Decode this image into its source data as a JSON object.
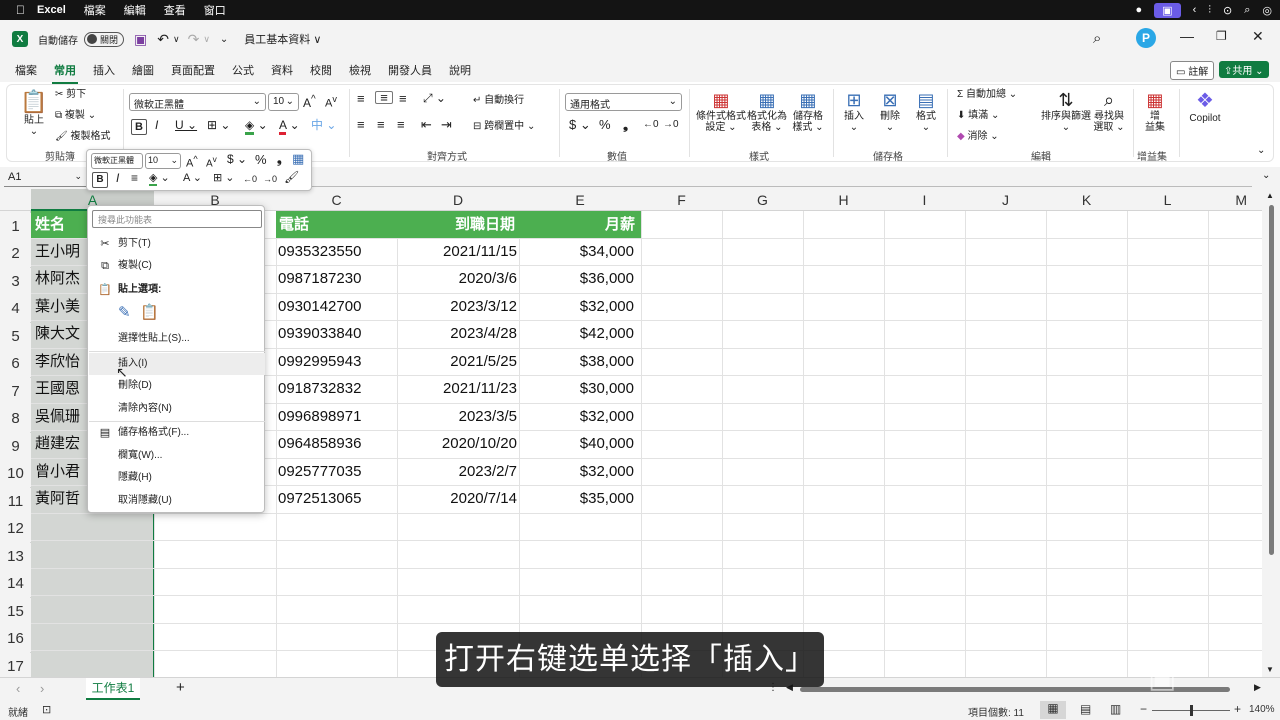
{
  "menubar": {
    "apple": "",
    "app": "Excel",
    "items": [
      "檔案",
      "編輯",
      "查看",
      "窗口"
    ]
  },
  "titlebar": {
    "autosave_label": "自動儲存",
    "autosave_state": "關閉",
    "doc_title": "員工基本資料 ∨"
  },
  "tabs": [
    "檔案",
    "常用",
    "插入",
    "繪圖",
    "頁面配置",
    "公式",
    "資料",
    "校閱",
    "檢視",
    "開發人員",
    "說明"
  ],
  "actions": {
    "comment": "註解",
    "share": "共用"
  },
  "ribbon": {
    "paste": "貼上",
    "cut": "剪下",
    "copy": "複製",
    "format_painter": "複製格式",
    "clipboard_label": "剪貼簿",
    "font_name": "微軟正黑體",
    "font_size": "10",
    "alignment_label": "對齊方式",
    "wrap_text": "自動換行",
    "merge_center": "跨欄置中",
    "number_format": "通用格式",
    "number_label": "數值",
    "cond_format": "條件式格式\n設定",
    "format_table": "格式化為\n表格",
    "cell_styles": "儲存格\n樣式",
    "styles_label": "樣式",
    "insert": "插入",
    "delete": "刪除",
    "format": "格式",
    "cells_label": "儲存格",
    "autosum": "自動加總",
    "fill": "填滿",
    "clear": "消除",
    "sort_filter": "排序與篩選",
    "find_select": "尋找與\n選取",
    "editing_label": "編輯",
    "addins": "增\n益集",
    "addins_label": "增益集",
    "copilot": "Copilot"
  },
  "namebox": "A1",
  "mini_toolbar": {
    "font_name": "微軟正黑體",
    "font_size": "10"
  },
  "columns": [
    "A",
    "B",
    "C",
    "D",
    "E",
    "F",
    "G",
    "H",
    "I",
    "J",
    "K",
    "L",
    "M"
  ],
  "rows": [
    "1",
    "2",
    "3",
    "4",
    "5",
    "6",
    "7",
    "8",
    "9",
    "10",
    "11",
    "12",
    "13",
    "14",
    "15",
    "16",
    "17"
  ],
  "table": {
    "headers": [
      "姓名",
      "電話",
      "到職日期",
      "月薪"
    ],
    "names": [
      "王小明",
      "林阿杰",
      "葉小美",
      "陳大文",
      "李欣怡",
      "王國恩",
      "吳佩珊",
      "趙建宏",
      "曾小君",
      "黃阿哲"
    ],
    "phones": [
      "0935323550",
      "0987187230",
      "0930142700",
      "0939033840",
      "0992995943",
      "0918732832",
      "0996898971",
      "0964858936",
      "0925777035",
      "0972513065"
    ],
    "dates": [
      "2021/11/15",
      "2020/3/6",
      "2023/3/12",
      "2023/4/28",
      "2021/5/25",
      "2021/11/23",
      "2023/3/5",
      "2020/10/20",
      "2023/2/7",
      "2020/7/14"
    ],
    "salaries": [
      "$34,000",
      "$36,000",
      "$32,000",
      "$42,000",
      "$38,000",
      "$30,000",
      "$32,000",
      "$40,000",
      "$32,000",
      "$35,000"
    ]
  },
  "context_menu": {
    "search_placeholder": "搜尋此功能表",
    "cut": "剪下(T)",
    "copy": "複製(C)",
    "paste_options": "貼上選項:",
    "paste_special": "選擇性貼上(S)...",
    "insert": "插入(I)",
    "delete": "刪除(D)",
    "clear": "清除內容(N)",
    "format_cells": "儲存格格式(F)...",
    "col_width": "欄寬(W)...",
    "hide": "隱藏(H)",
    "unhide": "取消隱藏(U)"
  },
  "sheet_tab": "工作表1",
  "status": {
    "ready": "就緒",
    "count": "項目個數: 11",
    "zoom": "140%"
  },
  "subtitle": "打开右键选单选择「插入」",
  "colors": {
    "excel_green": "#107c41",
    "header_fill": "#4caf50",
    "selected_col": "#c9cdc9"
  }
}
